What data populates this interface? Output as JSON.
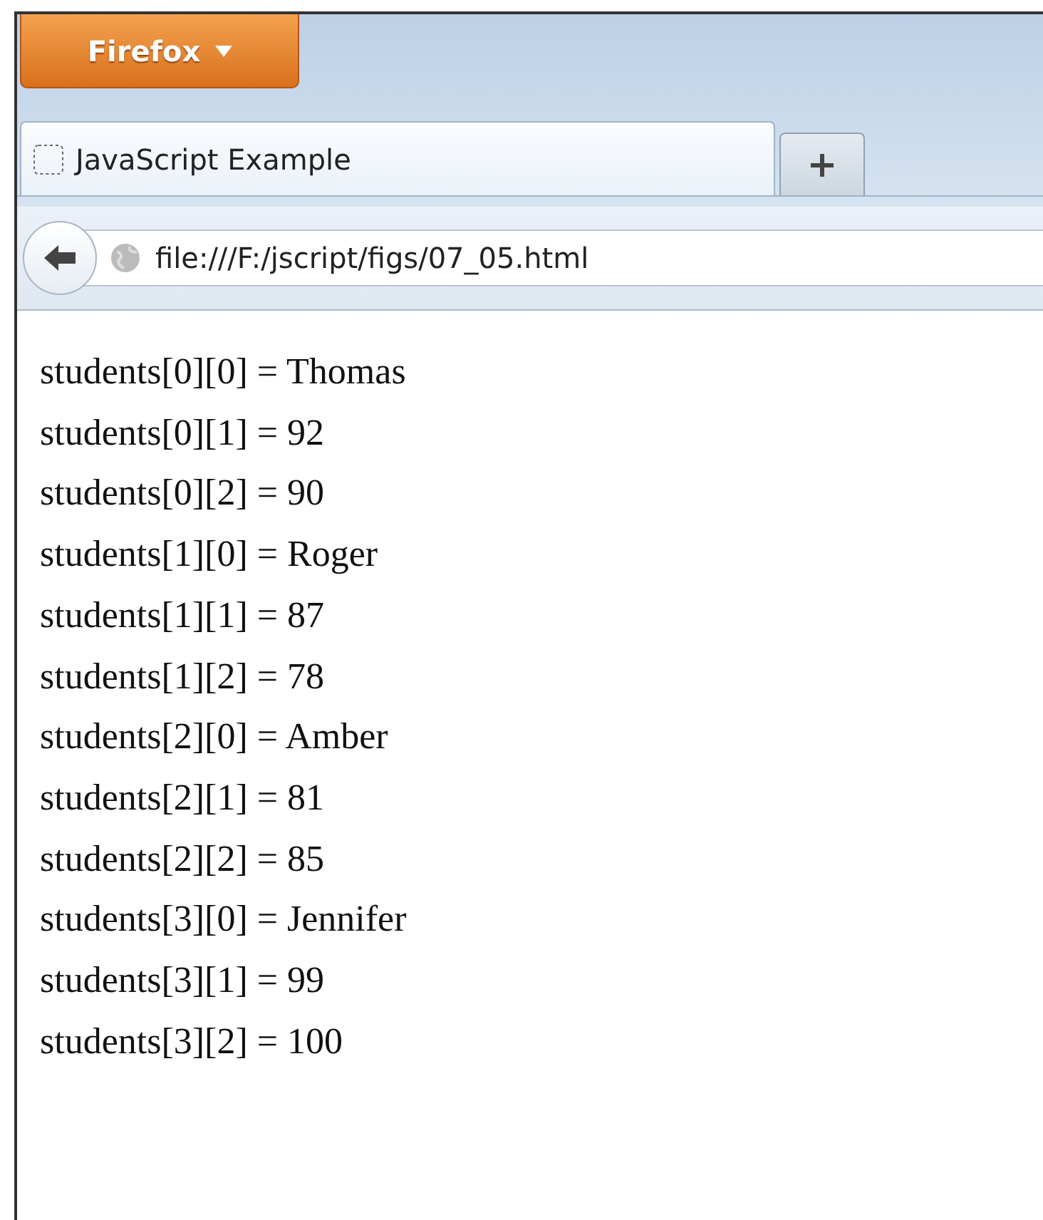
{
  "app_menu": {
    "label": "Firefox"
  },
  "tabs": [
    {
      "title": "JavaScript Example"
    }
  ],
  "address_bar": {
    "url": "file:///F:/jscript/figs/07_05.html"
  },
  "content": {
    "lines": [
      "students[0][0] = Thomas",
      "students[0][1] = 92",
      "students[0][2] = 90",
      "students[1][0] = Roger",
      "students[1][1] = 87",
      "students[1][2] = 78",
      "students[2][0] = Amber",
      "students[2][1] = 81",
      "students[2][2] = 85",
      "students[3][0] = Jennifer",
      "students[3][1] = 99",
      "students[3][2] = 100"
    ]
  }
}
